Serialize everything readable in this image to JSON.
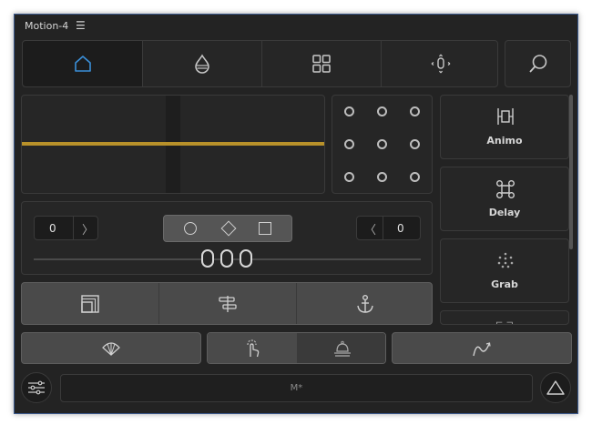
{
  "window": {
    "title": "Motion-4",
    "menu_icon": "hamburger-icon"
  },
  "tabs": [
    {
      "name": "home",
      "icon": "home-icon",
      "active": true
    },
    {
      "name": "drop",
      "icon": "drop-icon",
      "active": false
    },
    {
      "name": "grid",
      "icon": "grid-icon",
      "active": false
    },
    {
      "name": "anchor-point",
      "icon": "anchor-point-icon",
      "active": false
    }
  ],
  "search": {
    "icon": "search-icon"
  },
  "graph": {
    "curve_color": "#b8912a"
  },
  "anchor_grid": {
    "rows": 3,
    "cols": 3
  },
  "controls": {
    "left_value": "0",
    "right_value": "0",
    "shapes": [
      "circle",
      "diamond",
      "square"
    ],
    "slider_value": "000"
  },
  "side_tools": [
    {
      "label": "Animo",
      "icon": "animo-icon"
    },
    {
      "label": "Delay",
      "icon": "delay-icon"
    },
    {
      "label": "Grab",
      "icon": "grab-icon"
    }
  ],
  "action_bar": [
    {
      "name": "layer-bounds",
      "icon": "layer-bounds-icon"
    },
    {
      "name": "align",
      "icon": "align-icon"
    },
    {
      "name": "anchor",
      "icon": "anchor-icon"
    }
  ],
  "bottom_bar": {
    "left_icon": "fan-icon",
    "mid_left_icon": "touch-icon",
    "mid_right_icon": "bell-icon",
    "right_icon": "curve-icon"
  },
  "footer": {
    "settings_icon": "sliders-icon",
    "text": "M*",
    "triangle_icon": "triangle-icon"
  },
  "colors": {
    "accent_blue": "#3a8fd8",
    "curve_gold": "#b8912a",
    "background": "#232323"
  }
}
